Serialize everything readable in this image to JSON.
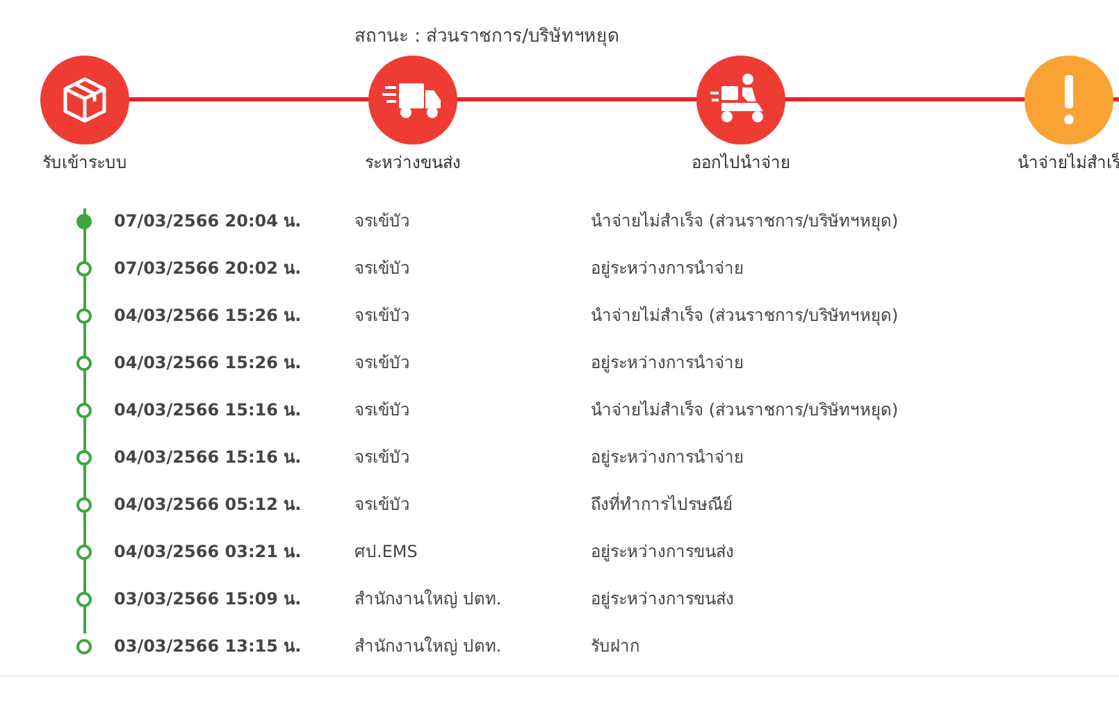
{
  "status_line": "สถานะ : ส่วนราชการ/บริษัทฯหยุด",
  "steps": [
    {
      "kind": "box",
      "label": "รับเข้าระบบ",
      "color": "#ee3b34"
    },
    {
      "kind": "truck",
      "label": "ระหว่างขนส่ง",
      "color": "#ee3b34"
    },
    {
      "kind": "scooter",
      "label": "ออกไปนำจ่าย",
      "color": "#ee3b34"
    },
    {
      "kind": "alert",
      "label": "นำจ่ายไม่สำเร็",
      "color": "#f8a334"
    }
  ],
  "events": [
    {
      "selected": true,
      "datetime": "07/03/2566 20:04 น.",
      "location": "จรเข้บัว",
      "status": "นำจ่ายไม่สำเร็จ (ส่วนราชการ/บริษัทฯหยุด)"
    },
    {
      "selected": false,
      "datetime": "07/03/2566 20:02 น.",
      "location": "จรเข้บัว",
      "status": "อยู่ระหว่างการนำจ่าย"
    },
    {
      "selected": false,
      "datetime": "04/03/2566 15:26 น.",
      "location": "จรเข้บัว",
      "status": "นำจ่ายไม่สำเร็จ (ส่วนราชการ/บริษัทฯหยุด)"
    },
    {
      "selected": false,
      "datetime": "04/03/2566 15:26 น.",
      "location": "จรเข้บัว",
      "status": "อยู่ระหว่างการนำจ่าย"
    },
    {
      "selected": false,
      "datetime": "04/03/2566 15:16 น.",
      "location": "จรเข้บัว",
      "status": "นำจ่ายไม่สำเร็จ (ส่วนราชการ/บริษัทฯหยุด)"
    },
    {
      "selected": false,
      "datetime": "04/03/2566 15:16 น.",
      "location": "จรเข้บัว",
      "status": "อยู่ระหว่างการนำจ่าย"
    },
    {
      "selected": false,
      "datetime": "04/03/2566 05:12 น.",
      "location": "จรเข้บัว",
      "status": "ถึงที่ทำการไปรษณีย์"
    },
    {
      "selected": false,
      "datetime": "04/03/2566 03:21 น.",
      "location": "ศป.EMS",
      "status": "อยู่ระหว่างการขนส่ง"
    },
    {
      "selected": false,
      "datetime": "03/03/2566 15:09 น.",
      "location": "สำนักงานใหญ่ ปตท.",
      "status": "อยู่ระหว่างการขนส่ง"
    },
    {
      "selected": false,
      "datetime": "03/03/2566 13:15 น.",
      "location": "สำนักงานใหญ่ ปตท.",
      "status": "รับฝาก"
    }
  ]
}
